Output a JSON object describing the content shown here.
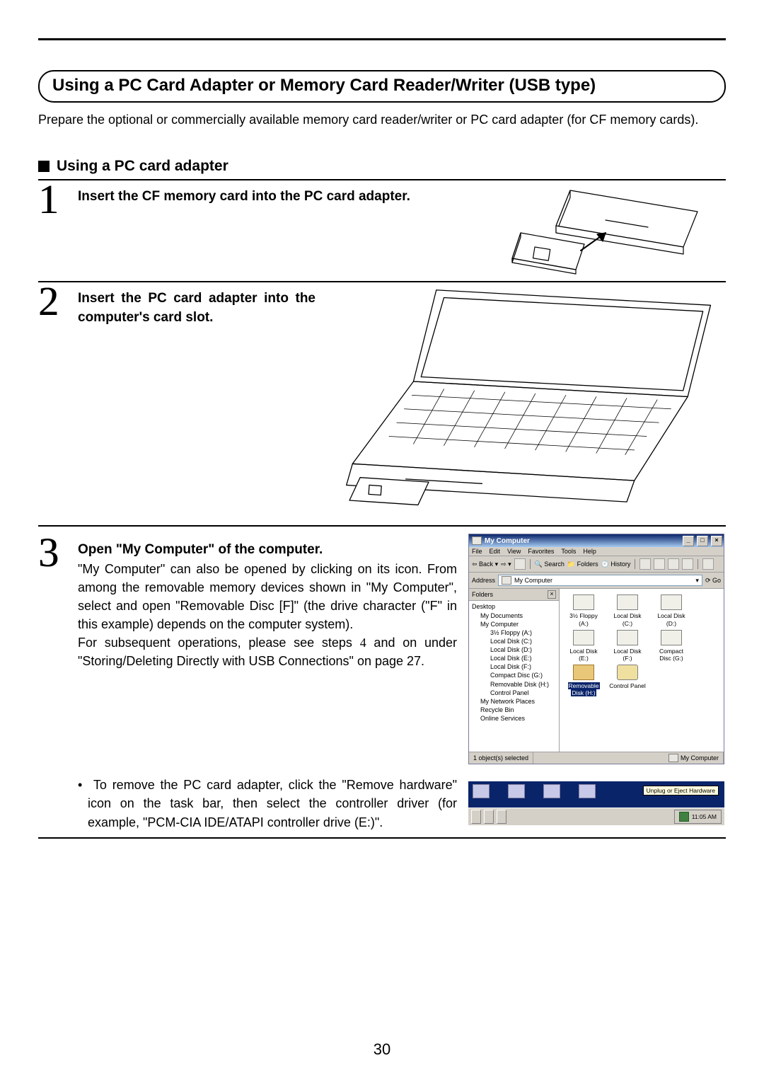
{
  "page_number": "30",
  "main_title": "Using a PC Card Adapter or Memory Card Reader/Writer (USB type)",
  "intro_text": "Prepare the optional or commercially available memory card reader/writer or PC card adapter (for CF memory cards).",
  "sub_heading": "Using a PC card adapter",
  "steps": {
    "s1_title": "Insert the CF memory card into the PC card adapter.",
    "s2_title": "Insert the PC card adapter into the computer's card slot.",
    "s3_title": "Open \"My Computer\" of the computer.",
    "s3_body1": "\"My Computer\" can also be opened by clicking on its icon. From among the removable memory devices shown in \"My Computer\", select and open \"Removable Disc [F]\" (the drive character (\"F\" in this example) depends on the computer system).",
    "s3_body2_a": "For subsequent operations, please see steps ",
    "s3_body2_b": " and on under \"Storing/Deleting Directly with USB Connections\" on page 27.",
    "s3_step_ref": "4",
    "bullet_text": "To remove the PC card adapter, click the \"Remove hardware\" icon on the task bar, then select the controller driver (for example, \"PCM-CIA IDE/ATAPI controller drive (E:)\"."
  },
  "window": {
    "title": "My Computer",
    "menu": [
      "File",
      "Edit",
      "View",
      "Favorites",
      "Tools",
      "Help"
    ],
    "toolbar": {
      "back": "Back",
      "search": "Search",
      "folders": "Folders",
      "history": "History"
    },
    "address_label": "Address",
    "address_value": "My Computer",
    "go": "Go",
    "folders_hdr": "Folders",
    "tree": {
      "desktop": "Desktop",
      "mydocs": "My Documents",
      "mycomp": "My Computer",
      "floppy": "3½ Floppy (A:)",
      "c": "Local Disk (C:)",
      "d": "Local Disk (D:)",
      "e": "Local Disk (E:)",
      "f": "Local Disk (F:)",
      "g": "Compact Disc (G:)",
      "h": "Removable Disk (H:)",
      "cp": "Control Panel",
      "mnp": "My Network Places",
      "rb": "Recycle Bin",
      "os": "Online Services"
    },
    "drives": {
      "a": "3½ Floppy (A:)",
      "c": "Local Disk (C:)",
      "d": "Local Disk (D:)",
      "e": "Local Disk (E:)",
      "f": "Local Disk (F:)",
      "g": "Compact Disc (G:)",
      "h1": "Removable",
      "h2": "Disk (H:)",
      "cp": "Control Panel"
    },
    "status_left": "1 object(s) selected",
    "status_right": "My Computer"
  },
  "tray": {
    "tooltip": "Unplug or Eject Hardware",
    "time": "11:05 AM"
  }
}
